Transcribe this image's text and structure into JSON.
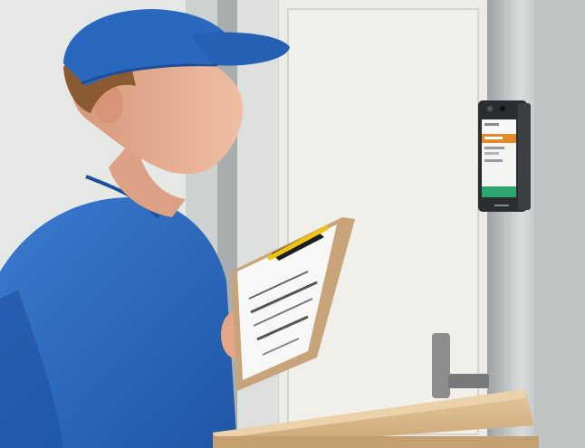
{
  "scene": {
    "palette": {
      "wall": "#e9e6e1",
      "wall_shadow": "#d9d6d0",
      "steel": "#b9bcbd",
      "steel_dark": "#8d9192",
      "steel_light": "#d8dbdb",
      "glass": "#dfe3e2",
      "uniform_blue": "#2f6fc4",
      "uniform_blue_dark": "#1f4f98",
      "cap_blue": "#2a67bf",
      "skin": "#e9b196",
      "skin_shadow": "#cc8c70",
      "hair": "#8a5a32",
      "clipboard": "#c9a47a",
      "paper": "#f7f7f5",
      "clip": "#1d1d1d",
      "pen_yellow": "#f1c40f",
      "box": "#d8b68a",
      "box_light": "#e7cba2",
      "handle": "#7e7f7f",
      "device_body": "#2b2e31",
      "device_screen": "#f4f4f2",
      "device_accent_green": "#2ea66f",
      "device_accent_orange": "#e08a2c"
    },
    "icons": {
      "terminal": "face-recognition-terminal-icon",
      "clipboard": "clipboard-icon",
      "parcel": "cardboard-box-icon"
    }
  }
}
